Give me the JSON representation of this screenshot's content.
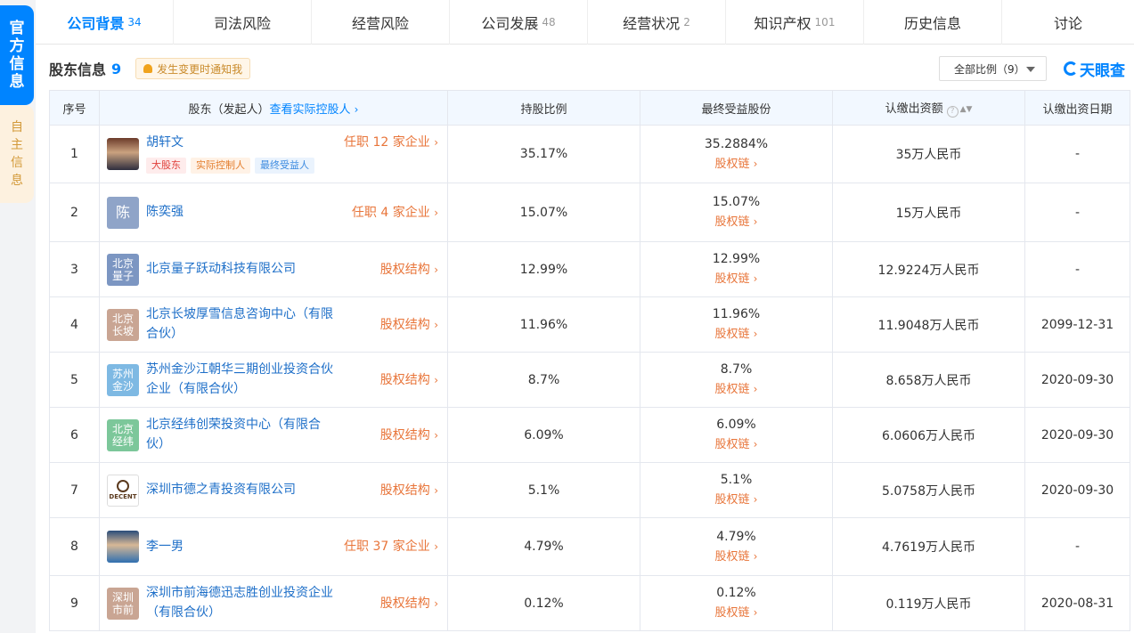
{
  "side": {
    "active_label": "官方信息",
    "inactive_label": "自主信息"
  },
  "tabs": [
    {
      "label": "公司背景",
      "count": "34"
    },
    {
      "label": "司法风险",
      "count": ""
    },
    {
      "label": "经营风险",
      "count": ""
    },
    {
      "label": "公司发展",
      "count": "48"
    },
    {
      "label": "经营状况",
      "count": "2"
    },
    {
      "label": "知识产权",
      "count": "101"
    },
    {
      "label": "历史信息",
      "count": ""
    },
    {
      "label": "讨论",
      "count": ""
    }
  ],
  "section": {
    "title": "股东信息",
    "count": "9",
    "notify": "发生变更时通知我"
  },
  "filter": {
    "label": "全部比例（9）"
  },
  "brand": {
    "name": "天眼查"
  },
  "table": {
    "headers": {
      "index": "序号",
      "holder": "股东（发起人）",
      "holder_link": "查看实际控股人",
      "ratio": "持股比例",
      "benefit": "最终受益股份",
      "capital": "认缴出资额",
      "date": "认缴出资日期"
    },
    "rows": [
      {
        "index": "1",
        "avatar": "",
        "name": "胡轩文",
        "name2": "",
        "link": "任职 12 家企业",
        "tags": [
          "大股东",
          "实际控制人",
          "最终受益人"
        ],
        "ratio": "35.17%",
        "benefit": "35.2884%",
        "benefit_link": "股权链",
        "capital": "35万人民币",
        "date": "-"
      },
      {
        "index": "2",
        "avatar": "陈",
        "name": "陈奕强",
        "name2": "",
        "link": "任职 4 家企业",
        "tags": [],
        "ratio": "15.07%",
        "benefit": "15.07%",
        "benefit_link": "股权链",
        "capital": "15万人民币",
        "date": "-"
      },
      {
        "index": "3",
        "avatar": "北京量子",
        "name": "北京量子跃动科技有限公司",
        "name2": "",
        "link": "股权结构",
        "tags": [],
        "ratio": "12.99%",
        "benefit": "12.99%",
        "benefit_link": "股权链",
        "capital": "12.9224万人民币",
        "date": "-"
      },
      {
        "index": "4",
        "avatar": "北京长坡",
        "name": "北京长坡厚雪信息咨询中心（有限",
        "name2": "合伙）",
        "link": "股权结构",
        "tags": [],
        "ratio": "11.96%",
        "benefit": "11.96%",
        "benefit_link": "股权链",
        "capital": "11.9048万人民币",
        "date": "2099-12-31"
      },
      {
        "index": "5",
        "avatar": "苏州金沙",
        "name": "苏州金沙江朝华三期创业投资合伙",
        "name2": "企业（有限合伙）",
        "link": "股权结构",
        "tags": [],
        "ratio": "8.7%",
        "benefit": "8.7%",
        "benefit_link": "股权链",
        "capital": "8.658万人民币",
        "date": "2020-09-30"
      },
      {
        "index": "6",
        "avatar": "北京经纬",
        "name": "北京经纬创荣投资中心（有限合",
        "name2": "伙）",
        "link": "股权结构",
        "tags": [],
        "ratio": "6.09%",
        "benefit": "6.09%",
        "benefit_link": "股权链",
        "capital": "6.0606万人民币",
        "date": "2020-09-30"
      },
      {
        "index": "7",
        "avatar": "DECENT",
        "name": "深圳市德之青投资有限公司",
        "name2": "",
        "link": "股权结构",
        "tags": [],
        "ratio": "5.1%",
        "benefit": "5.1%",
        "benefit_link": "股权链",
        "capital": "5.0758万人民币",
        "date": "2020-09-30"
      },
      {
        "index": "8",
        "avatar": "",
        "name": "李一男",
        "name2": "",
        "link": "任职 37 家企业",
        "tags": [],
        "ratio": "4.79%",
        "benefit": "4.79%",
        "benefit_link": "股权链",
        "capital": "4.7619万人民币",
        "date": "-"
      },
      {
        "index": "9",
        "avatar": "深圳市前",
        "name": "深圳市前海德迅志胜创业投资企业",
        "name2": "（有限合伙）",
        "link": "股权结构",
        "tags": [],
        "ratio": "0.12%",
        "benefit": "0.12%",
        "benefit_link": "股权链",
        "capital": "0.119万人民币",
        "date": "2020-08-31"
      }
    ]
  },
  "colors": {
    "accent": "#0084ff",
    "link_orange": "#e8753a",
    "holder_link": "#1e6fc8",
    "header_bg": "#f2f8ff"
  },
  "icons": {
    "notify": "bell-icon",
    "filter_caret": "caret-down-icon",
    "sort": "sort-icon",
    "help": "help-circle-icon",
    "chevron": "chevron-right-icon"
  }
}
